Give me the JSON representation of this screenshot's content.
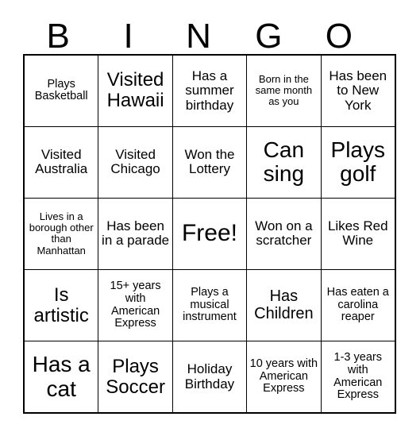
{
  "card": {
    "title": "BINGO",
    "header_letters": [
      "B",
      "I",
      "N",
      "G",
      "O"
    ],
    "grid_size": "5x5",
    "colors": {
      "background": "#ffffff",
      "text": "#000000",
      "border": "#000000"
    },
    "rows": [
      [
        {
          "text": "Plays Basketball",
          "size": "sm",
          "free": false
        },
        {
          "text": "Visited Hawaii",
          "size": "xl",
          "free": false
        },
        {
          "text": "Has a summer birthday",
          "size": "md",
          "free": false
        },
        {
          "text": "Born in the same month as you",
          "size": "xs",
          "free": false
        },
        {
          "text": "Has been to New York",
          "size": "md",
          "free": false
        }
      ],
      [
        {
          "text": "Visited Australia",
          "size": "md",
          "free": false
        },
        {
          "text": "Visited Chicago",
          "size": "md",
          "free": false
        },
        {
          "text": "Won the Lottery",
          "size": "md",
          "free": false
        },
        {
          "text": "Can sing",
          "size": "xxl",
          "free": false
        },
        {
          "text": "Plays golf",
          "size": "xxl",
          "free": false
        }
      ],
      [
        {
          "text": "Lives in a borough other than Manhattan",
          "size": "xs",
          "free": false
        },
        {
          "text": "Has been in a parade",
          "size": "md",
          "free": false
        },
        {
          "text": "Free!",
          "size": "free",
          "free": true
        },
        {
          "text": "Won on a scratcher",
          "size": "md",
          "free": false
        },
        {
          "text": "Likes Red Wine",
          "size": "md",
          "free": false
        }
      ],
      [
        {
          "text": "Is artistic",
          "size": "xl",
          "free": false
        },
        {
          "text": "15+ years with American Express",
          "size": "sm",
          "free": false
        },
        {
          "text": "Plays a musical instrument",
          "size": "sm",
          "free": false
        },
        {
          "text": "Has Children",
          "size": "lg",
          "free": false
        },
        {
          "text": "Has eaten a carolina reaper",
          "size": "sm",
          "free": false
        }
      ],
      [
        {
          "text": "Has a cat",
          "size": "xxl",
          "free": false
        },
        {
          "text": "Plays Soccer",
          "size": "xl",
          "free": false
        },
        {
          "text": "Holiday Birthday",
          "size": "md",
          "free": false
        },
        {
          "text": "10 years with American Express",
          "size": "sm",
          "free": false
        },
        {
          "text": "1-3 years with American Express",
          "size": "sm",
          "free": false
        }
      ]
    ]
  }
}
